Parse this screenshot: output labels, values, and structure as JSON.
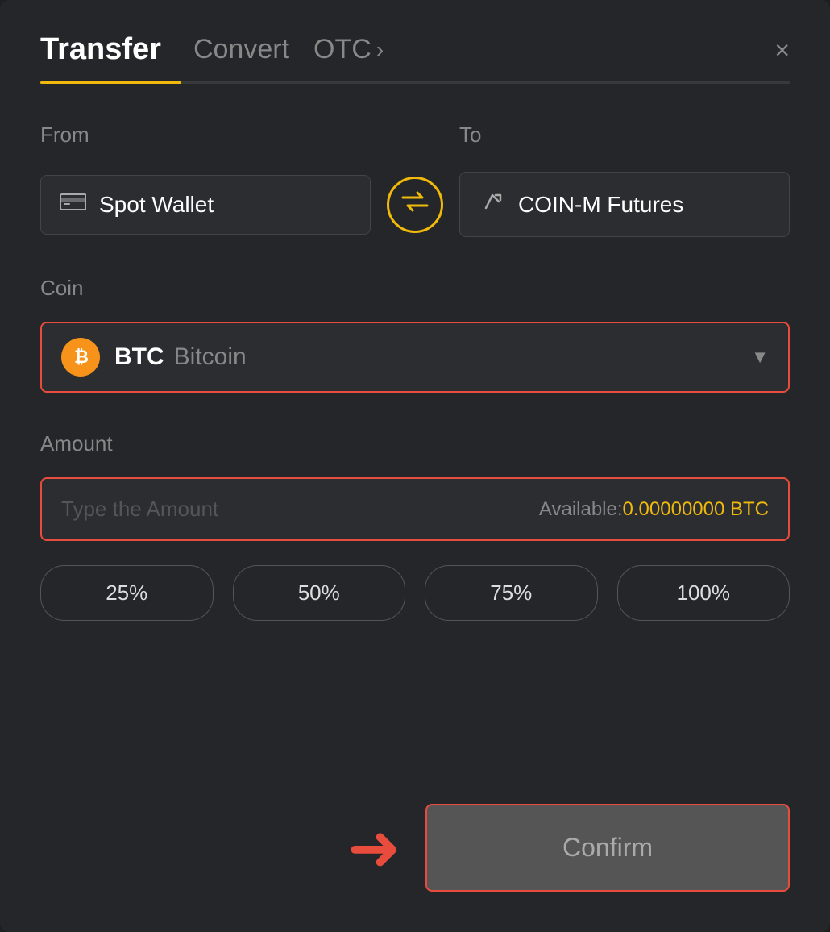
{
  "header": {
    "tab_transfer": "Transfer",
    "tab_convert": "Convert",
    "tab_otc": "OTC",
    "tab_otc_arrow": "›",
    "close_label": "×"
  },
  "from_section": {
    "label": "From",
    "wallet_name": "Spot Wallet",
    "wallet_icon": "🪪"
  },
  "to_section": {
    "label": "To",
    "futures_name": "COIN-M Futures",
    "futures_icon": "↑"
  },
  "coin_section": {
    "label": "Coin",
    "coin_ticker": "BTC",
    "coin_name": "Bitcoin",
    "chevron": "▼"
  },
  "amount_section": {
    "label": "Amount",
    "placeholder": "Type the Amount",
    "available_label": "Available:",
    "available_amount": "0.00000000 BTC"
  },
  "percent_buttons": [
    "25%",
    "50%",
    "75%",
    "100%"
  ],
  "confirm_button": {
    "label": "Confirm"
  }
}
